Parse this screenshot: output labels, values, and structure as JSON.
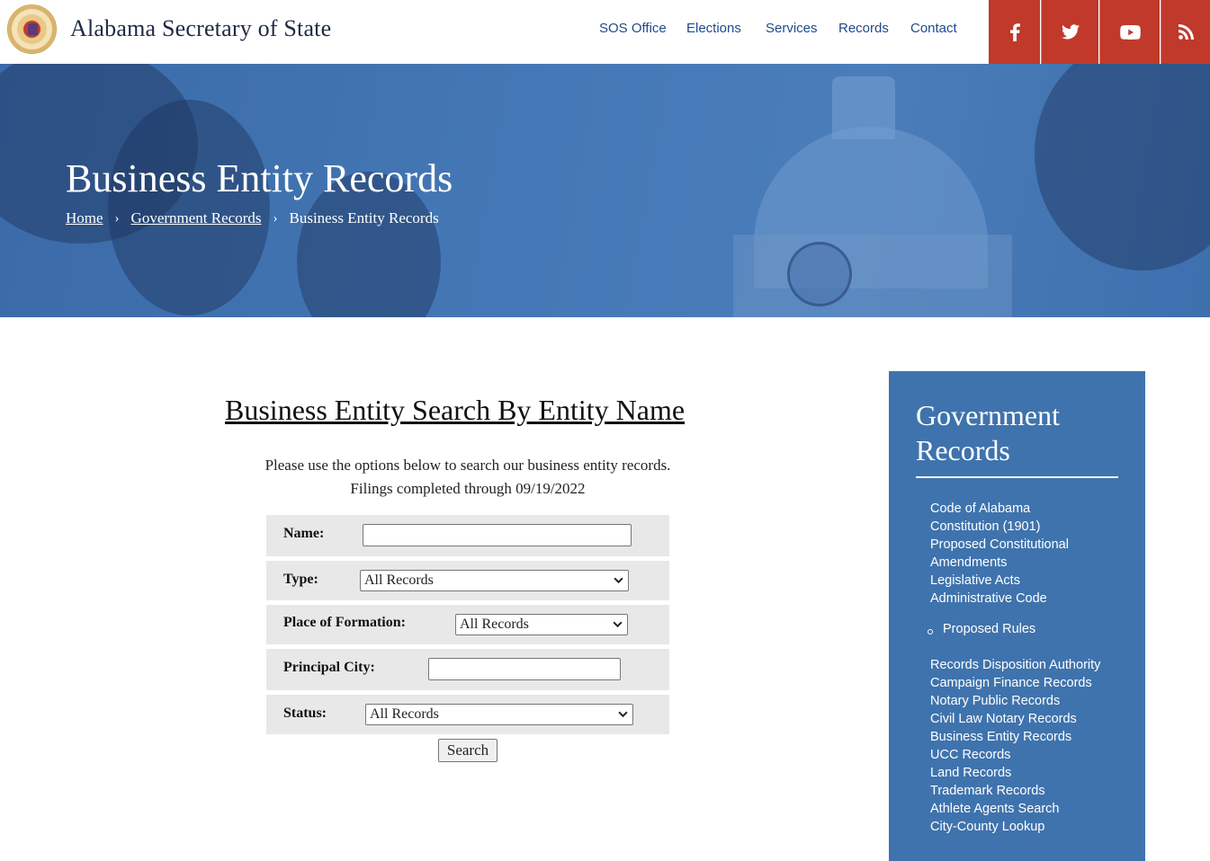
{
  "header": {
    "site_title": "Alabama Secretary of State",
    "nav": [
      "SOS Office",
      "Elections",
      "Services",
      "Records",
      "Contact"
    ],
    "social_icons": [
      "facebook-icon",
      "twitter-icon",
      "youtube-icon",
      "rss-icon"
    ],
    "social_color": "#c0392b"
  },
  "hero": {
    "title": "Business Entity Records",
    "breadcrumb": [
      "Home",
      "Government Records",
      "Business Entity Records"
    ],
    "separator": "›"
  },
  "search": {
    "heading": "Business Entity Search By Entity Name",
    "intro_line1": "Please use the options below to search our business entity records.",
    "intro_line2": "Filings completed through 09/19/2022",
    "fields": {
      "name_label": "Name:",
      "name_value": "",
      "type_label": "Type:",
      "type_value": "All Records",
      "formation_label": "Place of Formation:",
      "formation_value": "All Records",
      "city_label": "Principal City:",
      "city_value": "",
      "status_label": "Status:",
      "status_value": "All Records"
    },
    "button_label": "Search"
  },
  "sidebar": {
    "title": "Government Records",
    "links": [
      "Code of Alabama",
      "Constitution (1901)",
      "Proposed Constitutional",
      "Amendments",
      "Legislative Acts",
      "Administrative Code",
      "Proposed Rules",
      "Records Disposition Authority",
      "Campaign Finance Records",
      "Notary Public Records",
      "Civil Law Notary Records",
      "Business Entity Records",
      "UCC Records",
      "Land Records",
      "Trademark Records",
      "Athlete Agents Search",
      "City-County Lookup"
    ],
    "bg_color": "#3f73ad"
  }
}
